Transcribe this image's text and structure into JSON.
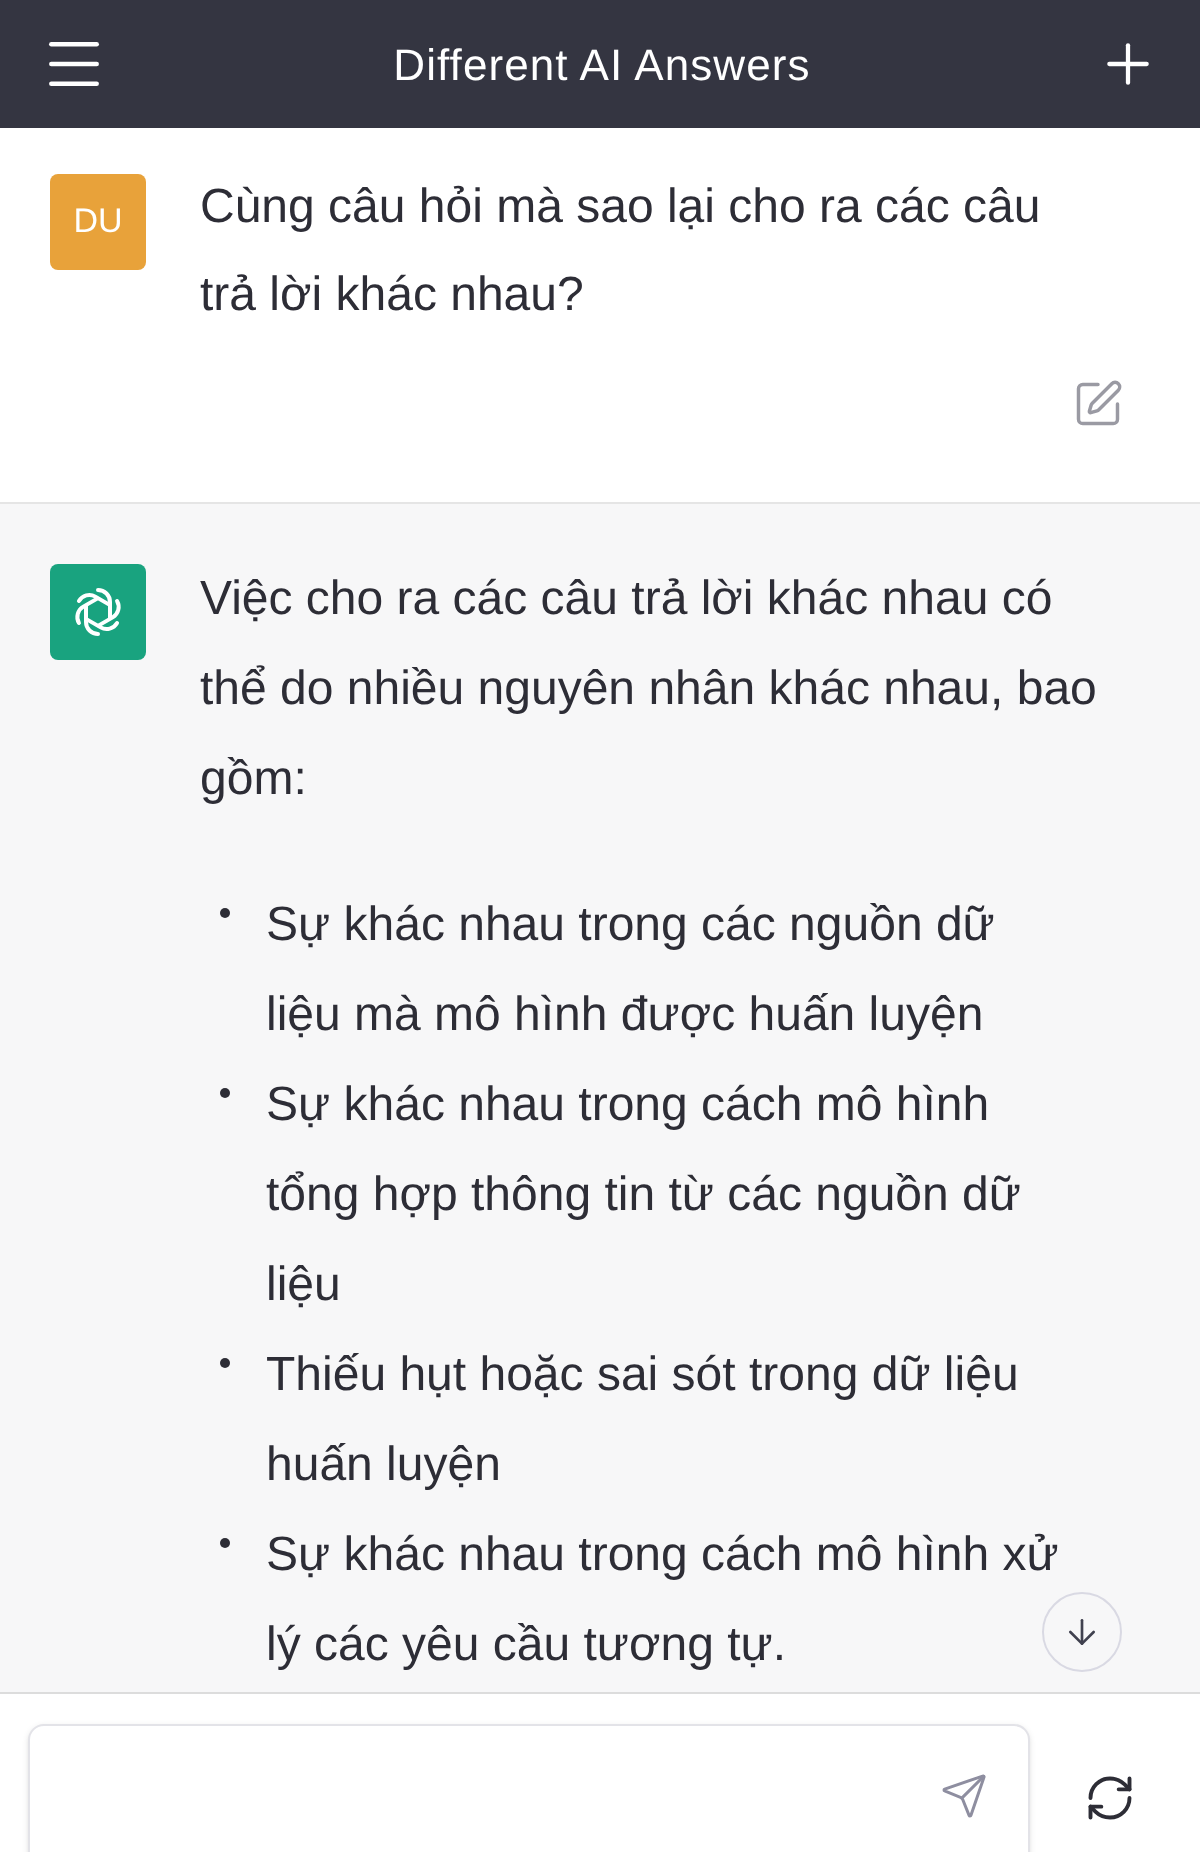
{
  "header": {
    "title": "Different AI Answers"
  },
  "user_message": {
    "avatar": "DU",
    "text": "Cùng câu hỏi mà sao lại cho ra các câu trả lời khác nhau?"
  },
  "ai_message": {
    "intro": "Việc cho ra các câu trả lời khác nhau có thể do nhiều nguyên nhân khác nhau, bao gồm:",
    "bullets": [
      "Sự khác nhau trong các nguồn dữ liệu mà mô hình được huấn luyện",
      "Sự khác nhau trong cách mô hình tổng hợp thông tin từ các nguồn dữ liệu",
      "Thiếu hụt hoặc sai sót trong dữ liệu huấn luyện",
      "Sự khác nhau trong cách mô hình xử lý các yêu cầu tương tự."
    ]
  }
}
